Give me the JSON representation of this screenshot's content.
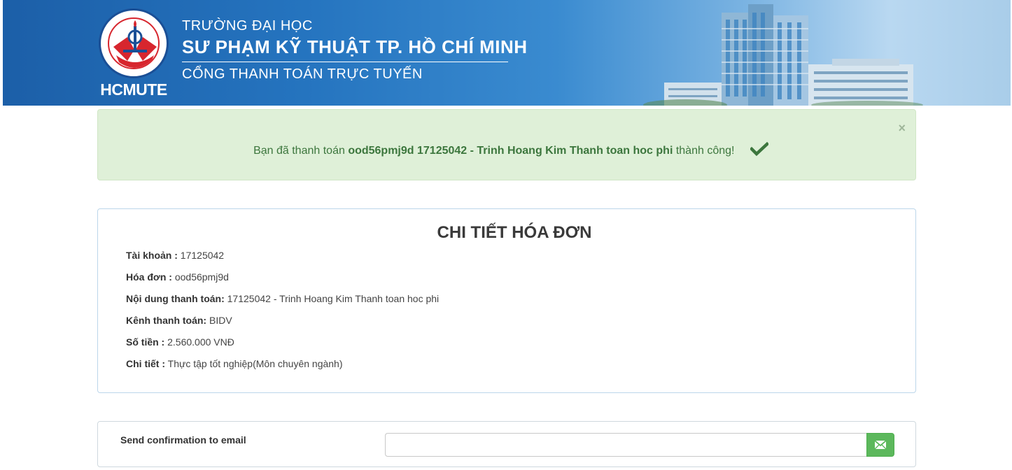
{
  "header": {
    "logo_text": "HCMUTE",
    "line1": "TRƯỜNG ĐẠI HỌC",
    "line2": "SƯ PHẠM KỸ THUẬT TP. HỒ CHÍ MINH",
    "line3": "CỔNG THANH TOÁN TRỰC TUYẾN"
  },
  "alert": {
    "prefix": "Bạn đã thanh toán ",
    "bold_text": "ood56pmj9d 17125042 - Trinh Hoang Kim Thanh toan hoc phi",
    "suffix": " thành công!",
    "close_symbol": "×",
    "icon": "check-icon"
  },
  "invoice": {
    "title": "CHI TIẾT HÓA ĐƠN",
    "rows": [
      {
        "label": "Tài khoản :",
        "value": "17125042"
      },
      {
        "label": "Hóa đơn :",
        "value": "ood56pmj9d"
      },
      {
        "label": "Nội dung thanh toán:",
        "value": "17125042 - Trinh Hoang Kim Thanh toan hoc phi"
      },
      {
        "label": "Kênh thanh toán:",
        "value": "BIDV"
      },
      {
        "label": "Số tiền :",
        "value": "2.560.000 VNĐ"
      },
      {
        "label": "Chi tiết :",
        "value": "Thực tập tốt nghiệp(Môn chuyên ngành)"
      }
    ]
  },
  "email": {
    "label": "Send confirmation to email",
    "value": "",
    "button_icon": "envelope-icon"
  },
  "colors": {
    "banner": "#2574bf",
    "alert_bg": "#dff0d8",
    "alert_text": "#3c763d",
    "send_button": "#5cb85c"
  }
}
